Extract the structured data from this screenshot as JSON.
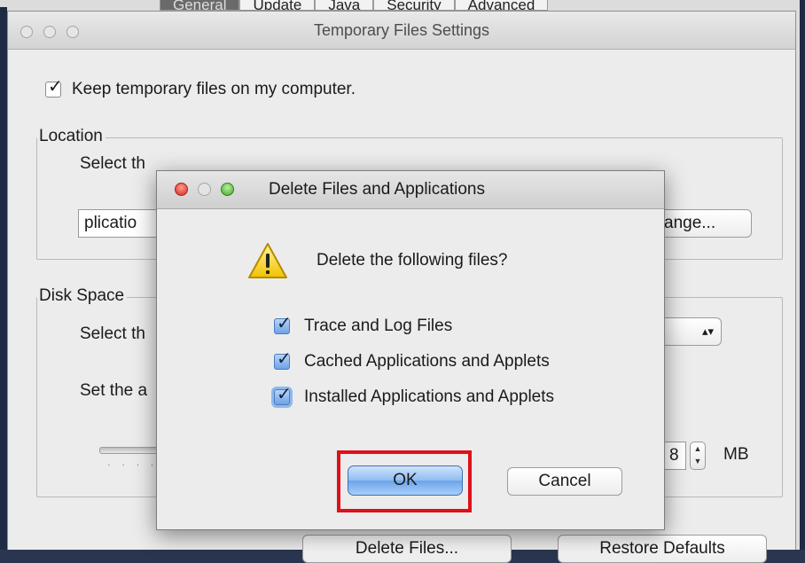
{
  "background": {
    "tabs": [
      "General",
      "Update",
      "Java",
      "Security",
      "Advanced"
    ],
    "selected_tab": "General"
  },
  "temp_window": {
    "title": "Temporary Files Settings",
    "keep_checkbox_label": "Keep temporary files on my computer.",
    "keep_checked": true,
    "location_group_title": "Location",
    "location_prompt": "Select th",
    "location_field_value": "plicatio",
    "change_button_label": "ange...",
    "disk_space_group_title": "Disk Space",
    "disk_space_prompt": "Select th",
    "set_prompt": "Set the a",
    "size_value": "8",
    "size_unit": "MB",
    "delete_files_button": "Delete Files...",
    "restore_defaults_button": "Restore Defaults"
  },
  "dialog": {
    "title": "Delete Files and Applications",
    "message": "Delete the following files?",
    "options": [
      {
        "label": "Trace and Log Files",
        "checked": true
      },
      {
        "label": "Cached Applications and Applets",
        "checked": true
      },
      {
        "label": "Installed Applications and Applets",
        "checked": true
      }
    ],
    "ok_label": "OK",
    "cancel_label": "Cancel",
    "highlight_color": "#e0101a"
  }
}
